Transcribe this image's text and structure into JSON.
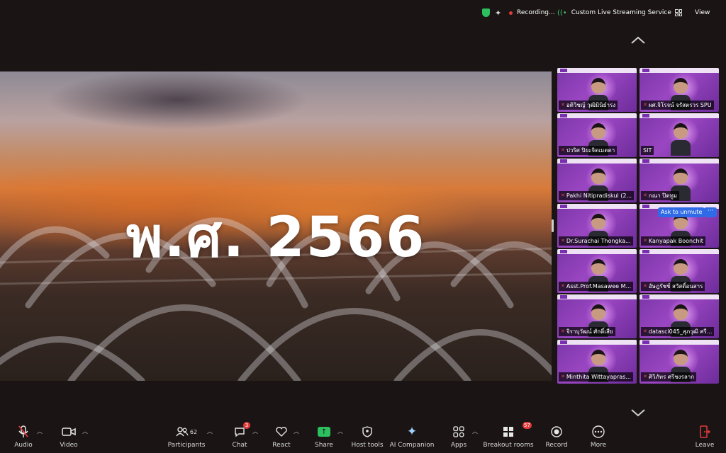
{
  "topbar": {
    "recording_label": "Recording...",
    "stream_label": "Custom Live Streaming Service",
    "view_label": "View",
    "colors": {
      "shield": "#2dbf5f",
      "recording": "#e23b3b",
      "stream": "#3ec46d"
    }
  },
  "share_screen": {
    "text": "พ.ศ. 2566"
  },
  "gallery": {
    "tiles": [
      {
        "name": "อติวิชญ์ วุฒิมินิธำรง",
        "mic_muted": true
      },
      {
        "name": "ผศ.จิโรจน์ จรัสตรวร SPU",
        "mic_muted": true
      },
      {
        "name": "ปวริศ ปิยะจิตเมตตา",
        "mic_muted": true
      },
      {
        "name": "SIT",
        "mic_muted": false
      },
      {
        "name": "Pakhi Nitipradiskul (2...",
        "mic_muted": true
      },
      {
        "name": "กณา ปิดทูม",
        "mic_muted": true
      },
      {
        "name": "Dr.Surachai Thongka...",
        "mic_muted": true
      },
      {
        "name": "Kanyapak Boonchit",
        "mic_muted": true
      },
      {
        "name": "Asst.Prof.Masawee M...",
        "mic_muted": true
      },
      {
        "name": "อัษฎรัชช์ สวัสดิ์อนสาร",
        "mic_muted": true
      },
      {
        "name": "จิราบุวัฒน์ ศักดิ์เสีย",
        "mic_muted": true
      },
      {
        "name": "datasci045_สุภวุฒิ ศรี...",
        "mic_muted": true
      },
      {
        "name": "Minthita Wittayapras...",
        "mic_muted": true
      },
      {
        "name": "ศิวิภัทร ศรีชงรลาก",
        "mic_muted": true
      }
    ],
    "ask_to_unmute": "Ask to unmute",
    "more": "···"
  },
  "toolbar": {
    "audio": "Audio",
    "video": "Video",
    "participants": "Participants",
    "participants_count": "62",
    "chat": "Chat",
    "chat_badge": "3",
    "react": "React",
    "share": "Share",
    "host_tools": "Host tools",
    "ai_companion": "AI Companion",
    "apps": "Apps",
    "breakout_rooms": "Breakout rooms",
    "breakout_badge": "57",
    "record": "Record",
    "more": "More",
    "leave": "Leave"
  }
}
